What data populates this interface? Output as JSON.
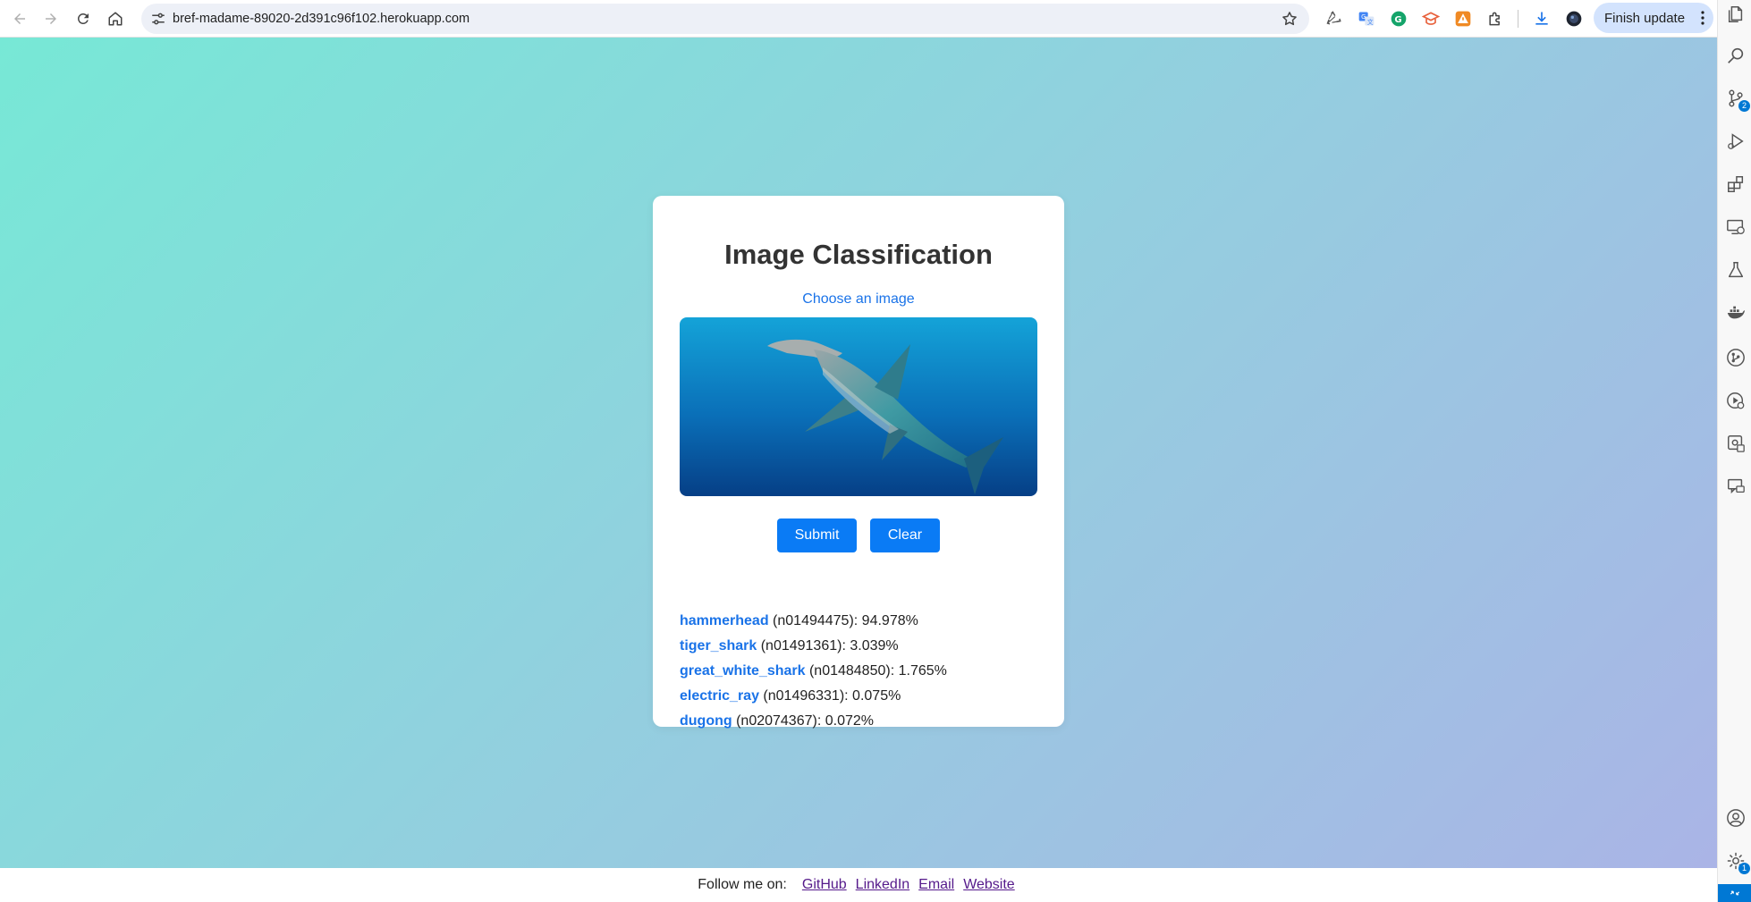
{
  "browser": {
    "url": "bref-madame-89020-2d391c96f102.herokuapp.com",
    "finish_update_label": "Finish update",
    "icons": [
      "back-arrow-icon",
      "forward-arrow-icon",
      "reload-icon",
      "home-icon",
      "site-info-icon",
      "bookmark-star-icon",
      "recycle-extension-icon",
      "translate-extension-icon",
      "grammarly-extension-icon",
      "academic-extension-icon",
      "alert-extension-icon",
      "puzzle-extensions-icon",
      "download-icon",
      "profile-avatar-icon",
      "more-vertical-icon"
    ]
  },
  "page": {
    "title": "Image Classification",
    "choose_label": "Choose an image",
    "submit_label": "Submit",
    "clear_label": "Clear",
    "results": [
      {
        "label": "hammerhead",
        "detail": " (n01494475): 94.978%"
      },
      {
        "label": "tiger_shark",
        "detail": " (n01491361): 3.039%"
      },
      {
        "label": "great_white_shark",
        "detail": " (n01484850): 1.765%"
      },
      {
        "label": "electric_ray",
        "detail": " (n01496331): 0.075%"
      },
      {
        "label": "dugong",
        "detail": " (n02074367): 0.072%"
      }
    ]
  },
  "footer": {
    "follow_text": "Follow me on:",
    "links": [
      "GitHub",
      "LinkedIn",
      "Email",
      "Website"
    ]
  },
  "activity_bar": {
    "source_control_badge": "2",
    "settings_badge": "1",
    "icons": [
      "explorer-icon",
      "search-icon",
      "source-control-icon",
      "run-debug-icon",
      "extensions-icon",
      "remote-explorer-icon",
      "testing-icon",
      "docker-icon",
      "git-graph-icon",
      "github-actions-icon",
      "containers-icon",
      "chat-icon",
      "account-icon",
      "settings-icon",
      "remote-status-icon"
    ]
  },
  "colors": {
    "accent": "#0a7bf5",
    "link": "#1a73e8",
    "gradient_start": "#77e8d6",
    "gradient_end": "#aab4e6"
  }
}
